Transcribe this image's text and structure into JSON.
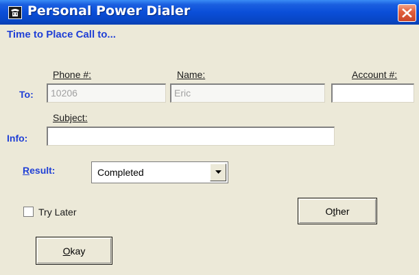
{
  "window": {
    "title": "Personal Power Dialer"
  },
  "dialog": {
    "heading": "Time to Place Call to...",
    "to_label": "To:",
    "info_label": "Info:",
    "phone": {
      "label": "Phone #:",
      "value": "10206"
    },
    "name": {
      "label": "Name:",
      "value": "Eric"
    },
    "account": {
      "label": "Account #:",
      "value": ""
    },
    "subject": {
      "label": "Subject:",
      "value": ""
    },
    "result": {
      "label_mnemonic": "R",
      "label_rest": "esult:",
      "selected": "Completed"
    },
    "try_later": {
      "label": "Try Later",
      "checked": false
    },
    "other_button": {
      "pre": "O",
      "mnemonic": "t",
      "post": "her"
    },
    "okay_button": {
      "mnemonic": "O",
      "rest": "kay"
    }
  },
  "icons": {
    "app": "phone-icon",
    "close": "close-icon",
    "dropdown": "chevron-down-icon"
  },
  "colors": {
    "title_bar": "#0a4ed8",
    "close_button": "#e2603e",
    "accent_text": "#1f3fd6",
    "dialog_bg": "#ece9d8"
  }
}
